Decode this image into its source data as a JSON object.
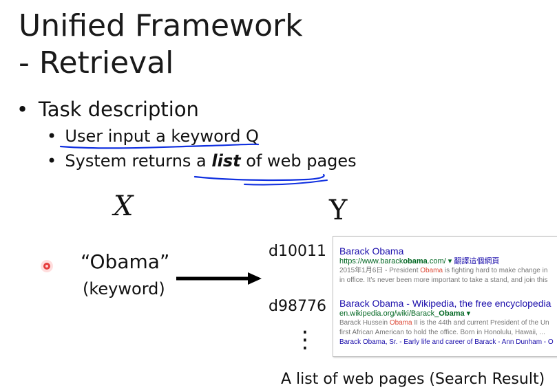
{
  "slide": {
    "title_line1": "Unified Framework",
    "title_line2": "- Retrieval",
    "bullet": "Task description",
    "sub1": "User input a keyword Q",
    "sub2_before": "System returns a ",
    "sub2_emph": "list",
    "sub2_after": " of web pages",
    "x_label": "X",
    "y_label": "Y",
    "keyword": "“Obama”",
    "keyword_label": "(keyword)",
    "doc_ids": [
      "d10011",
      "d98776"
    ],
    "vdots": "⋮",
    "caption": "A list of web pages (Search Result)"
  },
  "search_results": [
    {
      "title": "Barack Obama",
      "url_pre": "https://www.barack",
      "url_bold": "obama",
      "url_post": ".com/ ▾ ",
      "translate": "翻譯這個網頁",
      "snippet1_pre": "2015年1月6日 - President ",
      "snippet1_hl": "Obama",
      "snippet1_post": " is fighting hard to make change in",
      "snippet2": "in office. It's never been more important to take a stand, and join this"
    },
    {
      "title": "Barack Obama - Wikipedia, the free encyclopedia",
      "url_pre": "en.wikipedia.org/wiki/Barack_",
      "url_bold": "Obama",
      "url_post": " ▾",
      "snippet1_pre": "Barack Hussein ",
      "snippet1_hl": "Obama",
      "snippet1_post": " II is the 44th and current President of the Un",
      "snippet2": "first African American to hold the office. Born in Honolulu, Hawaii, ...",
      "sublinks": "Barack Obama, Sr. - Early life and career of Barack - Ann Dunham - O"
    }
  ],
  "colors": {
    "ink": "#1a1a1a",
    "pen_annotation": "#1030e0",
    "laser_pointer": "#e02020",
    "link": "#1a0dab",
    "url": "#006621",
    "snippet": "#777777",
    "highlight": "#dd4b39"
  }
}
